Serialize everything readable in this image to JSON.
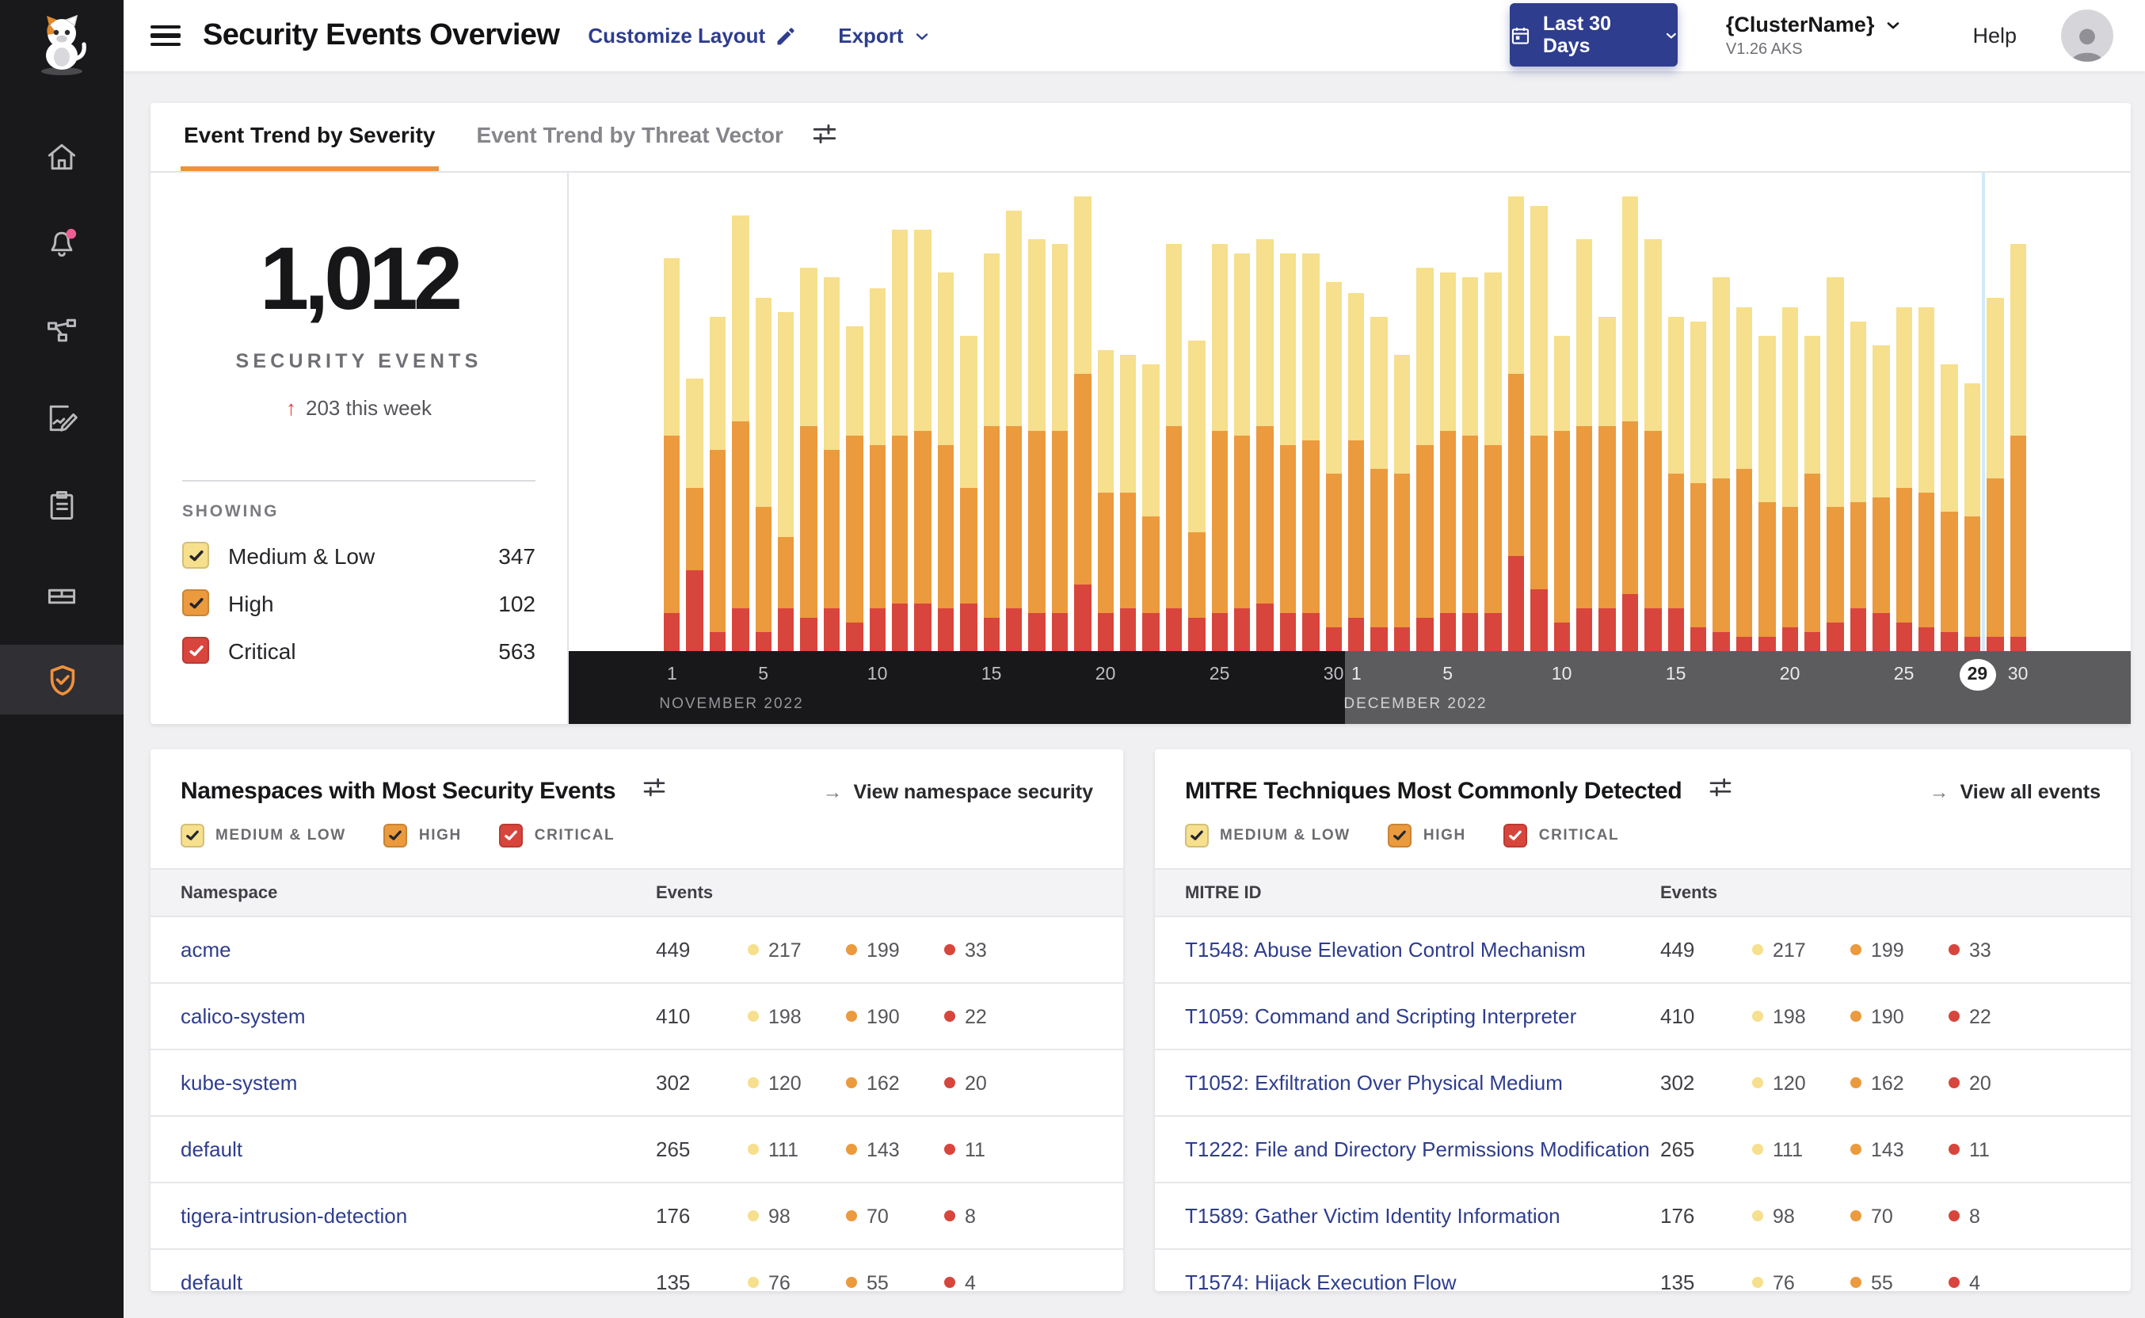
{
  "colors": {
    "navy": "#2e3d8d",
    "accent_orange": "#f0913c",
    "severity_medium_low": "#f6df8d",
    "severity_high": "#eb9a3e",
    "severity_critical": "#d8453c",
    "alert_dot_pink": "#ed5f94",
    "band_november": "#18181a",
    "band_december": "#5c5c5e",
    "today_line_blue": "#d3e9f6"
  },
  "header": {
    "title": "Security Events Overview",
    "customize": "Customize Layout",
    "export": "Export",
    "date_range": "Last 30 Days",
    "cluster_name": "{ClusterName}",
    "cluster_version": "V1.26 AKS",
    "help": "Help"
  },
  "sidebar": {
    "icons": [
      "calico-cat-logo",
      "home",
      "alerts-bell",
      "service-graph",
      "policy-edit",
      "compliance-clipboard",
      "workloads-box",
      "security-shield-active"
    ]
  },
  "tabs": {
    "severity": "Event Trend by Severity",
    "vector": "Event Trend by Threat Vector"
  },
  "summary": {
    "total": "1,012",
    "label": "SECURITY EVENTS",
    "delta_arrow": "↑",
    "delta": "203 this week",
    "showing": "SHOWING",
    "legend": [
      {
        "label": "Medium & Low",
        "count": 347
      },
      {
        "label": "High",
        "count": 102
      },
      {
        "label": "Critical",
        "count": 563
      }
    ]
  },
  "severity_filters": [
    "MEDIUM & LOW",
    "HIGH",
    "CRITICAL"
  ],
  "chart_data": {
    "type": "bar",
    "stacked": true,
    "title": "Event Trend by Severity",
    "x_range": "Nov 1, 2022 – Dec 30, 2022",
    "ylabel": "",
    "units": "percent of plot height (no y-axis shown)",
    "months": [
      {
        "label": "NOVEMBER 2022",
        "days": 30,
        "ticks": [
          1,
          5,
          10,
          15,
          20,
          25,
          30
        ]
      },
      {
        "label": "DECEMBER 2022",
        "days": 30,
        "ticks": [
          1,
          5,
          10,
          15,
          20,
          25,
          30
        ]
      }
    ],
    "highlight": {
      "selected_day": "29",
      "selected_month": "DECEMBER 2022",
      "line_before_index": 58
    },
    "series": [
      {
        "name": "Medium & Low",
        "color": "#f6df8d",
        "values": [
          37,
          23,
          28,
          43,
          44,
          47,
          33,
          36,
          23,
          33,
          43,
          42,
          36,
          32,
          36,
          45,
          40,
          39,
          37,
          30,
          29,
          32,
          38,
          40,
          39,
          38,
          39,
          40,
          39,
          40,
          31,
          32,
          25,
          37,
          33,
          33,
          36,
          37,
          48,
          20,
          39,
          23,
          47,
          40,
          33,
          34,
          42,
          34,
          35,
          42,
          29,
          48,
          38,
          32,
          38,
          39,
          31,
          28,
          38,
          40
        ]
      },
      {
        "name": "High",
        "color": "#eb9a3e",
        "values": [
          37,
          17,
          38,
          39,
          26,
          15,
          40,
          33,
          39,
          34,
          35,
          36,
          34,
          24,
          40,
          38,
          38,
          38,
          44,
          25,
          24,
          20,
          38,
          18,
          38,
          36,
          37,
          35,
          36,
          32,
          37,
          33,
          32,
          36,
          38,
          37,
          35,
          38,
          32,
          40,
          38,
          38,
          36,
          37,
          28,
          30,
          32,
          35,
          28,
          25,
          33,
          24,
          22,
          24,
          28,
          28,
          25,
          25,
          33,
          42
        ]
      },
      {
        "name": "Critical",
        "color": "#d8453c",
        "values": [
          8,
          17,
          4,
          9,
          4,
          9,
          7,
          9,
          6,
          9,
          10,
          10,
          9,
          10,
          7,
          9,
          8,
          8,
          14,
          8,
          9,
          8,
          9,
          7,
          8,
          9,
          10,
          8,
          8,
          5,
          7,
          5,
          5,
          7,
          8,
          8,
          8,
          20,
          13,
          6,
          9,
          9,
          12,
          9,
          9,
          5,
          4,
          3,
          3,
          5,
          4,
          6,
          9,
          8,
          6,
          5,
          4,
          3,
          3,
          3
        ]
      }
    ]
  },
  "namespaces": {
    "title": "Namespaces with Most Security Events",
    "link_arrow": "→",
    "link": "View namespace security",
    "col_name": "Namespace",
    "col_events": "Events",
    "rows": [
      {
        "name": "acme",
        "total": 449,
        "medium": 217,
        "high": 199,
        "critical": 33
      },
      {
        "name": "calico-system",
        "total": 410,
        "medium": 198,
        "high": 190,
        "critical": 22
      },
      {
        "name": "kube-system",
        "total": 302,
        "medium": 120,
        "high": 162,
        "critical": 20
      },
      {
        "name": "default",
        "total": 265,
        "medium": 111,
        "high": 143,
        "critical": 11
      },
      {
        "name": "tigera-intrusion-detection",
        "total": 176,
        "medium": 98,
        "high": 70,
        "critical": 8
      },
      {
        "name": "default",
        "total": 135,
        "medium": 76,
        "high": 55,
        "critical": 4
      }
    ]
  },
  "mitre": {
    "title": "MITRE Techniques Most Commonly Detected",
    "link_arrow": "→",
    "link": "View all events",
    "col_name": "MITRE ID",
    "col_events": "Events",
    "rows": [
      {
        "name": "T1548: Abuse Elevation Control Mechanism",
        "total": 449,
        "medium": 217,
        "high": 199,
        "critical": 33
      },
      {
        "name": "T1059: Command and Scripting Interpreter",
        "total": 410,
        "medium": 198,
        "high": 190,
        "critical": 22
      },
      {
        "name": "T1052: Exfiltration Over Physical Medium",
        "total": 302,
        "medium": 120,
        "high": 162,
        "critical": 20
      },
      {
        "name": "T1222: File and Directory Permissions Modification",
        "total": 265,
        "medium": 111,
        "high": 143,
        "critical": 11
      },
      {
        "name": "T1589: Gather Victim Identity Information",
        "total": 176,
        "medium": 98,
        "high": 70,
        "critical": 8
      },
      {
        "name": "T1574: Hijack Execution Flow",
        "total": 135,
        "medium": 76,
        "high": 55,
        "critical": 4
      }
    ]
  }
}
